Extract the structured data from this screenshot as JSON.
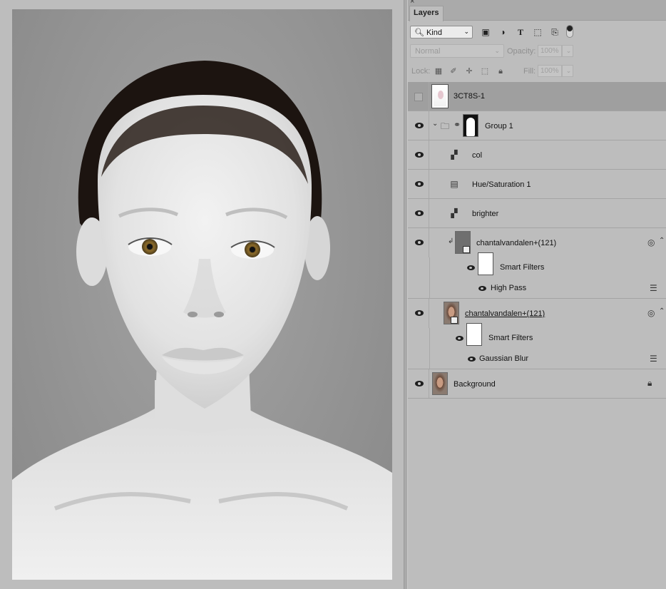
{
  "panel": {
    "tab_label": "Layers",
    "close_glyph": "×",
    "filter": {
      "kind_label": "Kind",
      "icons": [
        "image-filter-icon",
        "adjustment-filter-icon",
        "type-filter-icon",
        "shape-filter-icon",
        "smart-object-filter-icon"
      ]
    },
    "blend": {
      "mode": "Normal",
      "opacity_label": "Opacity:",
      "opacity_value": "100%",
      "fill_label": "Fill:",
      "fill_value": "100%"
    },
    "lock_label": "Lock:"
  },
  "layers": [
    {
      "name": "3CT8S-1",
      "visible": false,
      "selected": true
    },
    {
      "name": "Group 1",
      "visible": true
    },
    {
      "name": "col",
      "visible": true
    },
    {
      "name": "Hue/Saturation 1",
      "visible": true
    },
    {
      "name": "brighter",
      "visible": true
    },
    {
      "name": "chantalvandalen+(121)",
      "visible": true,
      "smart_filters": "Smart Filters",
      "filter": "High Pass"
    },
    {
      "name": "chantalvandalen+(121)",
      "visible": true,
      "smart_filters": "Smart Filters",
      "filter": "Gaussian Blur"
    },
    {
      "name": "Background",
      "visible": true,
      "locked": true
    }
  ]
}
